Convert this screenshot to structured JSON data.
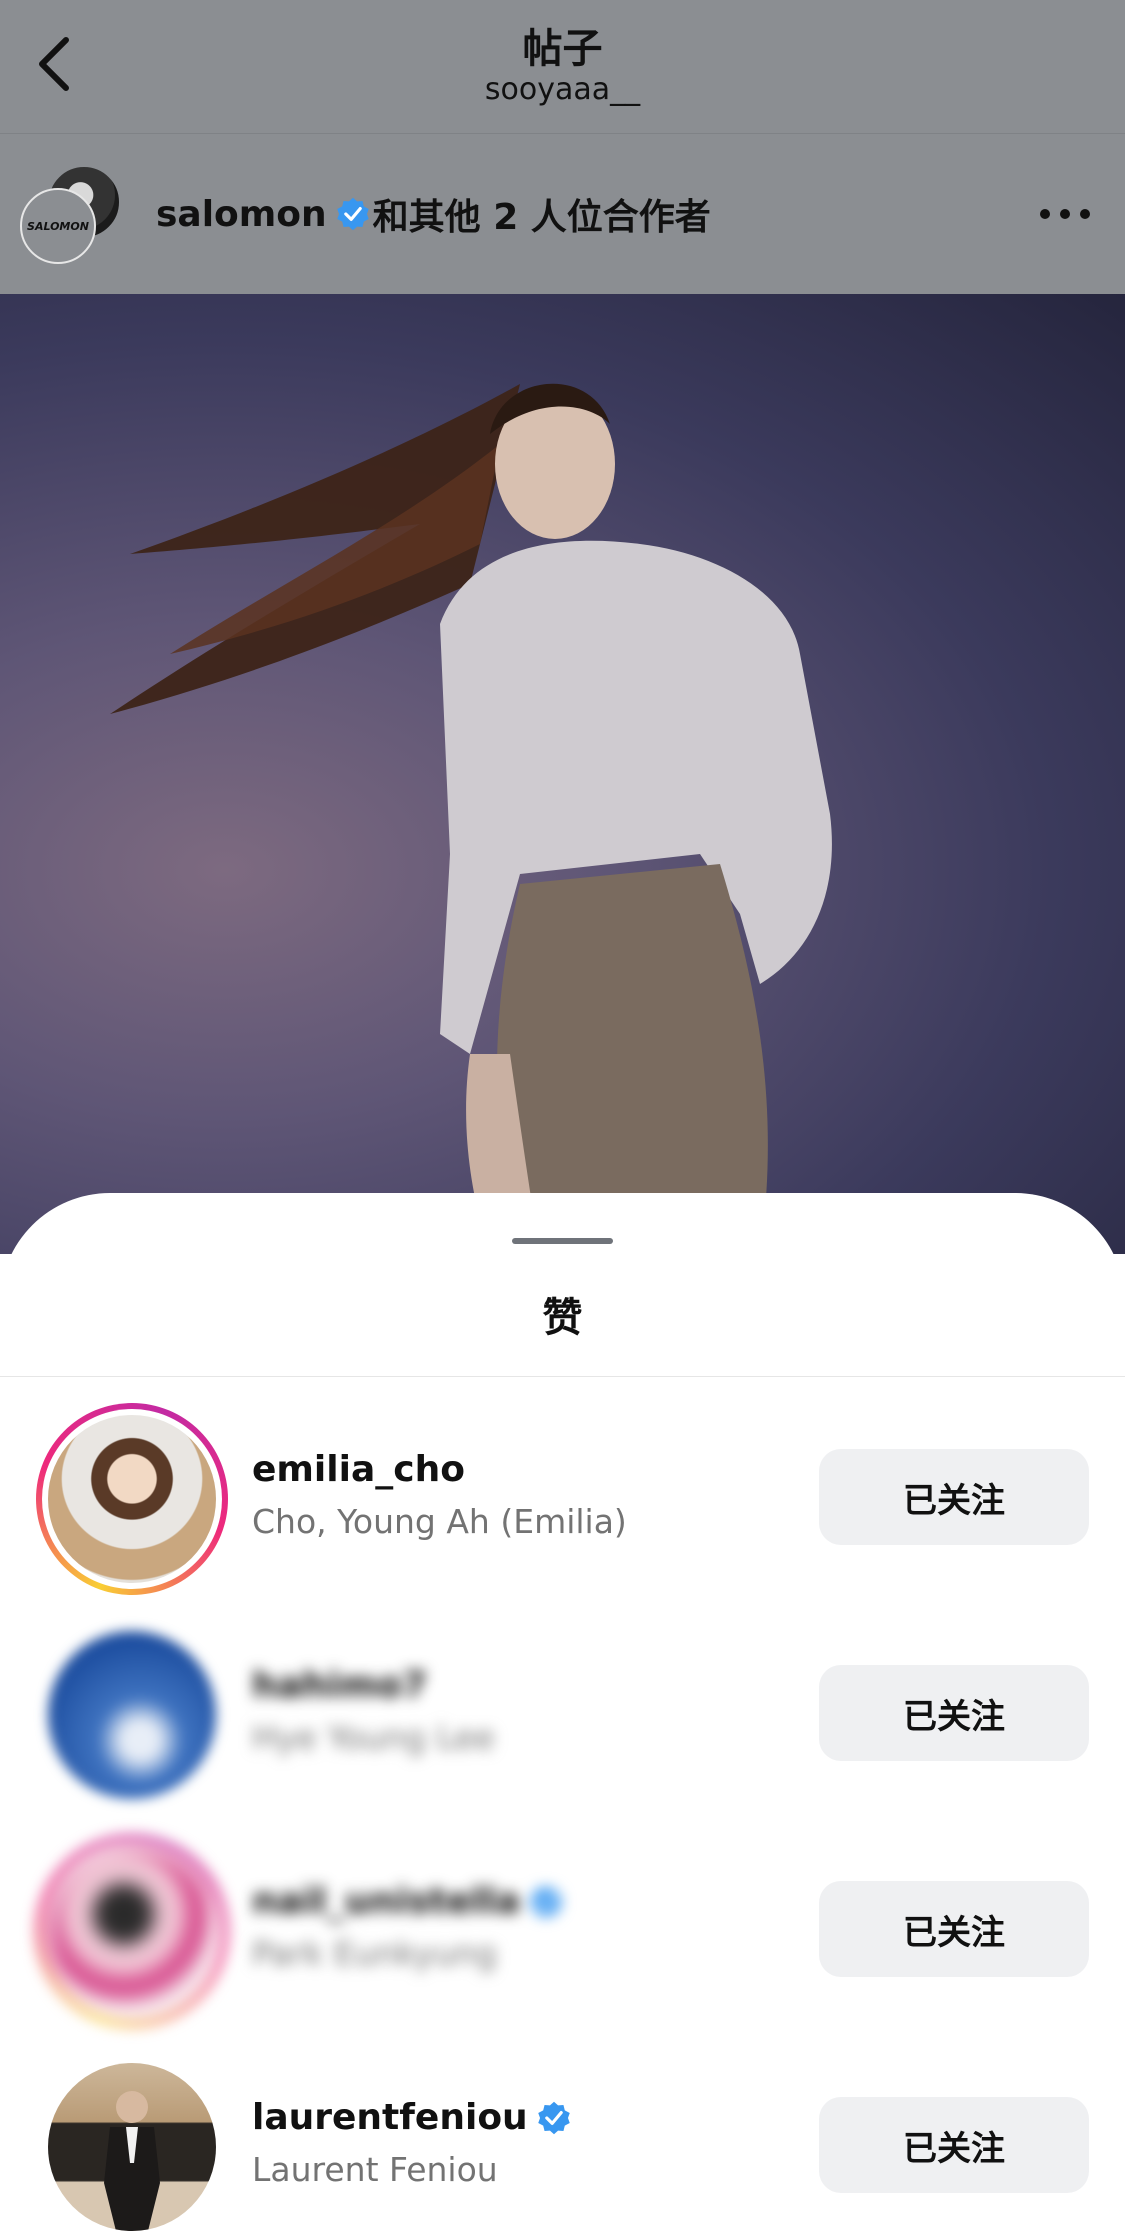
{
  "header": {
    "title": "帖子",
    "subtitle": "sooyaaa__"
  },
  "post": {
    "author": "salomon",
    "author_avatar_text": "SALOMON",
    "collab_text": "和其他 2 人位合作者"
  },
  "sheet": {
    "title": "赞",
    "users": [
      {
        "username": "emilia_cho",
        "fullname": "Cho, Young Ah (Emilia)",
        "verified": false,
        "button": "已关注"
      },
      {
        "username": "hahimo7",
        "fullname": "Hye Young Lee",
        "verified": false,
        "button": "已关注"
      },
      {
        "username": "nail_unistella",
        "fullname": "Park Eunkyung",
        "verified": true,
        "button": "已关注"
      },
      {
        "username": "laurentfeniou",
        "fullname": "Laurent Feniou",
        "verified": true,
        "button": "已关注"
      }
    ]
  },
  "colors": {
    "verified_blue": "#3897f0",
    "button_bg": "#eff0f2",
    "dim_overlay": "#8b8e92"
  }
}
